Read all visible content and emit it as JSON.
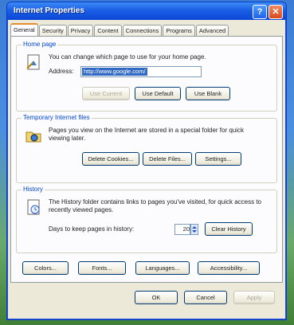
{
  "window": {
    "title": "Internet Properties",
    "help_btn": "?",
    "close_btn": "✕"
  },
  "tabs": [
    {
      "label": "General"
    },
    {
      "label": "Security"
    },
    {
      "label": "Privacy"
    },
    {
      "label": "Content"
    },
    {
      "label": "Connections"
    },
    {
      "label": "Programs"
    },
    {
      "label": "Advanced"
    }
  ],
  "home": {
    "legend": "Home page",
    "desc": "You can change which page to use for your home page.",
    "address_label": "Address:",
    "address_value": "http://www.google.com/",
    "btn_current": "Use Current",
    "btn_default": "Use Default",
    "btn_blank": "Use Blank"
  },
  "temp": {
    "legend": "Temporary Internet files",
    "desc": "Pages you view on the Internet are stored in a special folder for quick viewing later.",
    "btn_cookies": "Delete Cookies...",
    "btn_files": "Delete Files...",
    "btn_settings": "Settings..."
  },
  "history": {
    "legend": "History",
    "desc": "The History folder contains links to pages you've visited, for quick access to recently viewed pages.",
    "days_label": "Days to keep pages in history:",
    "days_value": "20",
    "btn_clear": "Clear History"
  },
  "bottom_buttons": {
    "colors": "Colors...",
    "fonts": "Fonts...",
    "languages": "Languages...",
    "accessibility": "Accessibility..."
  },
  "dialog_buttons": {
    "ok": "OK",
    "cancel": "Cancel",
    "apply": "Apply"
  }
}
